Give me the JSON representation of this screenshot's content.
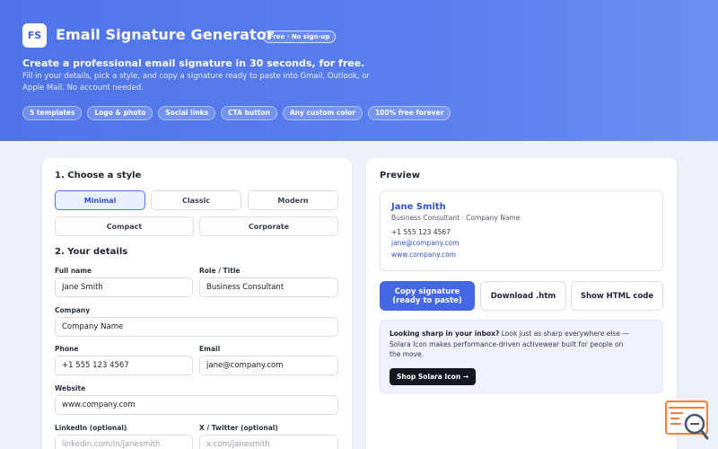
{
  "header": {
    "logo_text": "FS",
    "title": "Email Signature Generator",
    "badge": "Free · No sign-up",
    "headline": "Create a professional email signature in 30 seconds, for free.",
    "subline": "Fill in your details, pick a style, and copy a signature ready to paste into Gmail, Outlook, or Apple Mail. No account needed.",
    "chips": [
      "5 templates",
      "Logo & photo",
      "Social links",
      "CTA button",
      "Any custom color",
      "100% free forever"
    ]
  },
  "form": {
    "style_title": "1. Choose a style",
    "styles": [
      "Minimal",
      "Classic",
      "Modern",
      "Compact",
      "Corporate"
    ],
    "selected_style": "Minimal",
    "details_title": "2. Your details",
    "fields": {
      "full_name": {
        "label": "Full name",
        "value": "Jane Smith"
      },
      "role": {
        "label": "Role / Title",
        "value": "Business Consultant"
      },
      "company": {
        "label": "Company",
        "value": "Company Name"
      },
      "phone": {
        "label": "Phone",
        "value": "+1 555 123 4567"
      },
      "email": {
        "label": "Email",
        "value": "jane@company.com"
      },
      "website": {
        "label": "Website",
        "value": "www.company.com"
      },
      "linkedin": {
        "label": "LinkedIn (optional)",
        "placeholder": "linkedin.com/in/janesmith"
      },
      "twitter": {
        "label": "X / Twitter (optional)",
        "placeholder": "x.com/janesmith"
      }
    }
  },
  "preview": {
    "title": "Preview",
    "signature": {
      "name": "Jane Smith",
      "role_company": "Business Consultant · Company Name",
      "phone": "+1 555 123 4567",
      "email": "jane@company.com",
      "website": "www.company.com"
    },
    "actions": {
      "copy_line1": "Copy signature",
      "copy_line2": "(ready to paste)",
      "download": "Download .htm",
      "show_html": "Show HTML code"
    },
    "promo": {
      "bold": "Looking sharp in your inbox?",
      "text": " Look just as sharp everywhere else — Solara Icon makes performance-driven activewear built for people on the move.",
      "button": "Shop Solara Icon →"
    }
  },
  "colors": {
    "accent": "#4f74e8",
    "primary_button": "#4468e4",
    "link": "#3552c8",
    "promo_button": "#141821",
    "help_widget": "#ff7a3d"
  }
}
